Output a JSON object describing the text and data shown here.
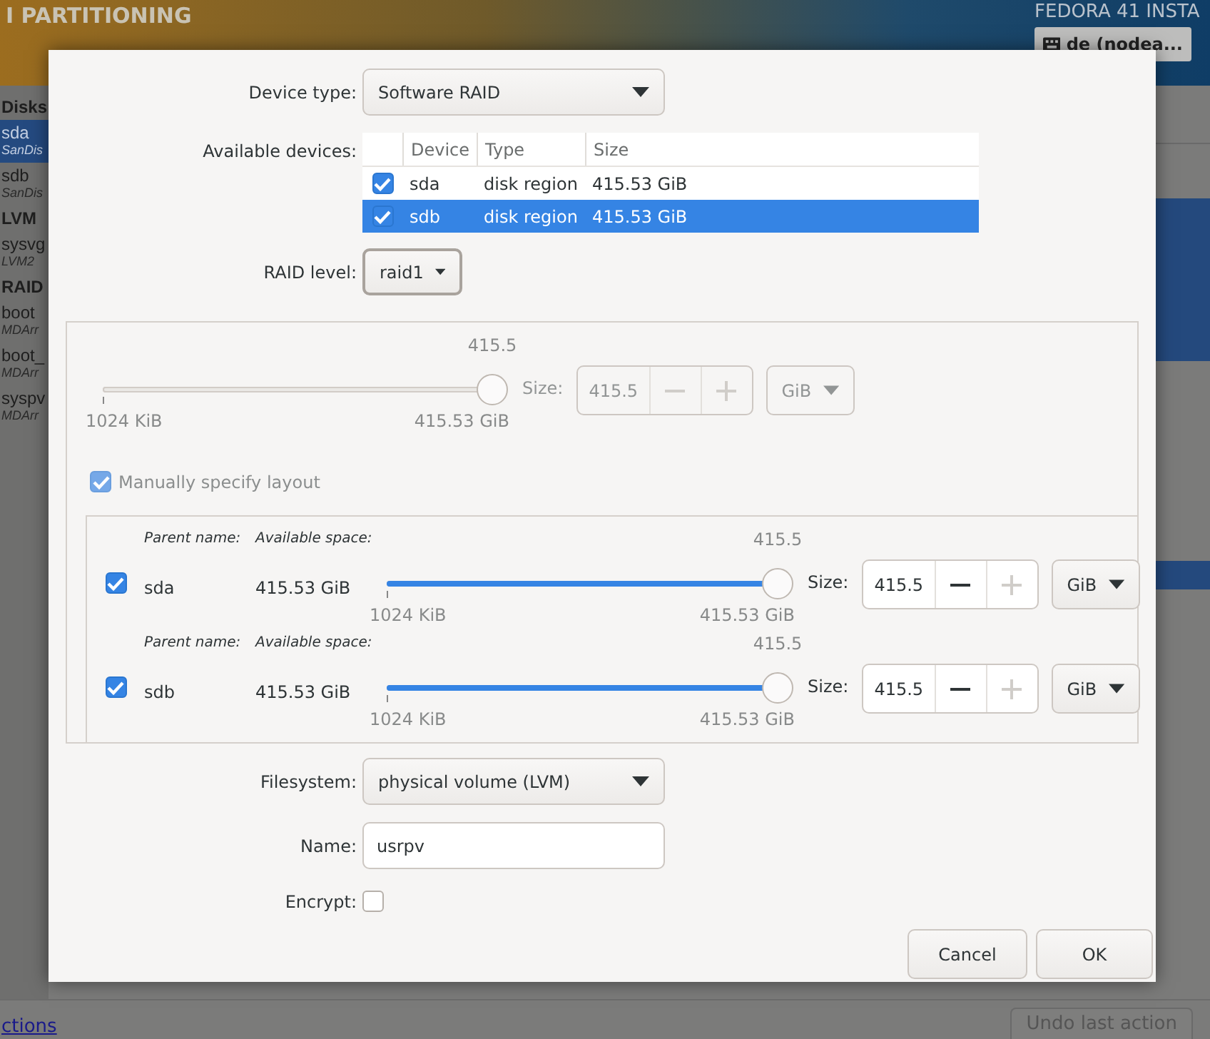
{
  "background": {
    "header_title": "I PARTITIONING",
    "product_title": "FEDORA 41 INSTA",
    "keyboard_layout": "de (nodea...",
    "sidebar": [
      {
        "heading": "Disks",
        "items": [
          {
            "name": "sda",
            "detail": "SanDis",
            "selected": true
          },
          {
            "name": "sdb",
            "detail": "SanDis",
            "selected": false
          }
        ]
      },
      {
        "heading": "LVM",
        "items": [
          {
            "name": "sysvg",
            "detail": "LVM2",
            "selected": false
          }
        ]
      },
      {
        "heading": "RAID",
        "items": [
          {
            "name": "boot",
            "detail": "MDArr",
            "selected": false
          },
          {
            "name": "boot_",
            "detail": "MDArr",
            "selected": false
          },
          {
            "name": "syspv",
            "detail": "MDArr",
            "selected": false
          }
        ]
      }
    ],
    "summary_link": "ctions",
    "undo_button": {
      "label": "Undo last action",
      "disabled": true
    }
  },
  "dialog": {
    "device_type": {
      "label": "Device type:",
      "value": "Software RAID"
    },
    "available_devices": {
      "label": "Available devices:",
      "columns": [
        "Device",
        "Type",
        "Size"
      ],
      "rows": [
        {
          "checked": true,
          "selected": false,
          "cells": [
            "sda",
            "disk region",
            "415.53 GiB"
          ]
        },
        {
          "checked": true,
          "selected": true,
          "cells": [
            "sdb",
            "disk region",
            "415.53 GiB"
          ]
        }
      ]
    },
    "raid_level": {
      "label": "RAID level:",
      "value": "raid1"
    },
    "size": {
      "disabled": true,
      "value_above": "415.5",
      "level": 1,
      "min_label": "1024 KiB",
      "max_label": "415.53 GiB",
      "size_label": "Size:",
      "spin_value": "415.5",
      "minus_disabled": true,
      "plus_disabled": true,
      "unit": "GiB"
    },
    "manual_layout": {
      "label": "Manually specify layout",
      "checked": true,
      "disabled": true
    },
    "parents": [
      {
        "parent_label": "Parent name:",
        "space_label": "Available space:",
        "checked": true,
        "name": "sda",
        "space": "415.53 GiB",
        "disabled": false,
        "value_above": "415.5",
        "level": 1,
        "min_label": "1024 KiB",
        "max_label": "415.53 GiB",
        "size_label": "Size:",
        "spin_value": "415.5",
        "minus_disabled": false,
        "plus_disabled": true,
        "unit": "GiB"
      },
      {
        "parent_label": "Parent name:",
        "space_label": "Available space:",
        "checked": true,
        "name": "sdb",
        "space": "415.53 GiB",
        "disabled": false,
        "value_above": "415.5",
        "level": 1,
        "min_label": "1024 KiB",
        "max_label": "415.53 GiB",
        "size_label": "Size:",
        "spin_value": "415.5",
        "minus_disabled": false,
        "plus_disabled": true,
        "unit": "GiB"
      }
    ],
    "filesystem": {
      "label": "Filesystem:",
      "value": "physical volume (LVM)"
    },
    "name": {
      "label": "Name:",
      "value": "usrpv"
    },
    "encrypt": {
      "label": "Encrypt:",
      "checked": false
    },
    "buttons": [
      {
        "label": "Cancel"
      },
      {
        "label": "OK"
      }
    ]
  }
}
